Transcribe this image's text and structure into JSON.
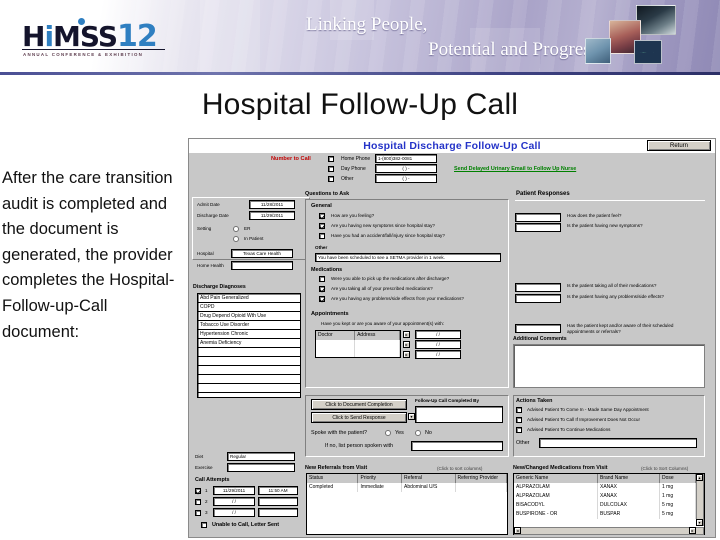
{
  "banner": {
    "logo_main": "HiMSS",
    "logo_i": "i",
    "logo_year": "12",
    "logo_sub": "ANNUAL CONFERENCE & EXHIBITION",
    "tagline_line1": "Linking People,",
    "tagline_line2": "Potential and Progress"
  },
  "slide": {
    "title": "Hospital Follow-Up Call",
    "body": "After the care transition audit is completed and the document is generated, the provider completes the Hospital-Follow-up-Call document:"
  },
  "app": {
    "title": "Hospital Discharge Follow-Up Call",
    "return_label": "Return",
    "number_to_call": {
      "label": "Number to Call",
      "rows": [
        {
          "checkbox_label": "Home Phone",
          "value": "1-(800)382-0081"
        },
        {
          "checkbox_label": "Day Phone",
          "value": "(  )   -"
        },
        {
          "checkbox_label": "Other",
          "value": "(  )   -"
        }
      ]
    },
    "send_email_link": "Send Delayed Urinary Email to Follow Up Nurse",
    "visit_info": {
      "admit_date_label": "Admit Date",
      "admit_date_value": "11/28/2011",
      "discharge_date_label": "Discharge Date",
      "discharge_date_value": "11/29/2011",
      "setting_label": "Setting",
      "setting_options": [
        "ER",
        "In Patient"
      ],
      "hospital_label": "Hospital",
      "hospital_value": "Texas Care Health",
      "home_health_label": "Home Health",
      "home_health_value": ""
    },
    "discharge_diagnoses": {
      "title": "Discharge Diagnoses",
      "items": [
        "Abd Pain Generalized",
        "COPD",
        "Drug Depend Opioid Wth Use",
        "Tobacco Use Disorder",
        "Hypertension Chronic",
        "Anemia Deficiency",
        "",
        "",
        "",
        "",
        ""
      ]
    },
    "diet": {
      "label": "Diet",
      "value": "Regular"
    },
    "exercise": {
      "label": "Exercise",
      "value": ""
    },
    "call_attempts": {
      "title": "Call Attempts",
      "rows": [
        {
          "num": "1",
          "checked": true,
          "date": "11/29/2011",
          "time": "11:50 AM"
        },
        {
          "num": "2",
          "checked": false,
          "date": "/  /",
          "time": ""
        },
        {
          "num": "3",
          "checked": false,
          "date": "/  /",
          "time": ""
        }
      ],
      "unable_label": "Unable to Call, Letter Sent"
    },
    "questions": {
      "title": "Questions to Ask",
      "general_label": "General",
      "general": [
        {
          "checked": true,
          "text": "How are you feeling?"
        },
        {
          "checked": true,
          "text": "Are you having new symptoms since hospital stay?"
        },
        {
          "checked": false,
          "text": "Have you had an accident/fall/injury since hospital stay?"
        }
      ],
      "other_label": "Other",
      "other_value": "You have been scheduled to see a SETMA provider in 1 week.",
      "medications_label": "Medications",
      "medications": [
        {
          "checked": false,
          "text": "Were you able to pick up the medications after discharge?"
        },
        {
          "checked": true,
          "text": "Are you taking all of your prescribed medications?"
        },
        {
          "checked": true,
          "text": "Are you having any problems/side effects from your medications?"
        }
      ],
      "appointments_label": "Appointments",
      "appointments_question": "Have you kept or are you aware of your appointment(s) with:",
      "appointments_cols": [
        "Doctor",
        "Address"
      ],
      "appointments_dates": [
        "/  /",
        "/  /",
        "/  /"
      ]
    },
    "patient_responses": {
      "title": "Patient Responses",
      "items": [
        {
          "value": "",
          "text": "How does the patient feel?"
        },
        {
          "value": "",
          "text": "Is the patient having new symptoms?"
        },
        {
          "value": "",
          "text": "Is the patient taking all of their medications?"
        },
        {
          "value": "",
          "text": "Is the patient having any problems/side effects?"
        },
        {
          "value": "",
          "text": "Has the patient kept and/or aware of their scheduled appointments or referrals?"
        }
      ],
      "comments_label": "Additional Comments",
      "comments_value": ""
    },
    "completion": {
      "document_btn": "Click to Document Completion",
      "send_btn": "Click to Send Response",
      "completed_by_label": "Follow-Up Call Completed By",
      "completed_by_value": "",
      "spoke_label": "Spoke with the patient?",
      "spoke_options": [
        "Yes",
        "No"
      ],
      "if_no_label": "If no, list person spoken with",
      "if_no_value": ""
    },
    "actions_taken": {
      "title": "Actions Taken",
      "items": [
        {
          "checked": false,
          "text": "Advised Patient To Come In - Made Same Day Appointment"
        },
        {
          "checked": false,
          "text": "Advised Patient To Call If Improvement Does Not Occur"
        },
        {
          "checked": false,
          "text": "Advised Patient To Continue Medications"
        }
      ],
      "other_label": "Other",
      "other_value": ""
    },
    "referrals": {
      "title": "New Referrals from Visit",
      "hint": "(Click to sort columns)",
      "columns": [
        "Status",
        "Priority",
        "Referral",
        "Referring Provider"
      ],
      "rows": [
        [
          "Completed",
          "Immediate",
          "Abdominal U/S",
          ""
        ]
      ]
    },
    "medications_table": {
      "title": "New/Changed Medications from Visit",
      "hint": "(Click to Sort Columns)",
      "columns": [
        "Generic Name",
        "Brand Name",
        "Dose"
      ],
      "rows": [
        [
          "ALPRAZOLAM",
          "XANAX",
          "1 mg"
        ],
        [
          "ALPRAZOLAM",
          "XANAX",
          "1 mg"
        ],
        [
          "BISACODYL",
          "DULCOLAX",
          "5 mg"
        ],
        [
          "BUSPIRONE - OR",
          "BUSPAR",
          "5 mg"
        ]
      ]
    }
  }
}
